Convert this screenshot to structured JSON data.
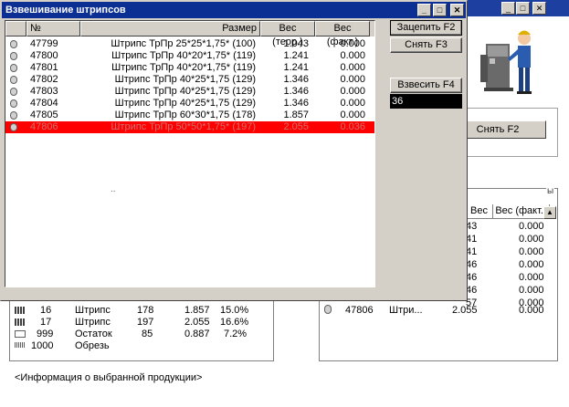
{
  "background": {
    "right_button_label": "Снять F2",
    "group_caption_fragment": "ы",
    "right_table": {
      "headers": [
        "Вес",
        "Вес (факт.)"
      ],
      "rows": [
        {
          "w": "43",
          "f": "0.000"
        },
        {
          "w": "41",
          "f": "0.000"
        },
        {
          "w": "41",
          "f": "0.000"
        },
        {
          "w": "46",
          "f": "0.000"
        },
        {
          "w": "46",
          "f": "0.000"
        },
        {
          "w": "46",
          "f": "0.000"
        },
        {
          "w": "57",
          "f": "0.000"
        }
      ],
      "last_row": {
        "no": "47806",
        "name": "Штри...",
        "w": "2.055",
        "f": "0.000"
      }
    },
    "left_table_rows": [
      {
        "n": "16",
        "name": "Штрипс",
        "len": "178",
        "w": "1.857",
        "pct": "15.0%"
      },
      {
        "n": "17",
        "name": "Штрипс",
        "len": "197",
        "w": "2.055",
        "pct": "16.6%"
      },
      {
        "n": "999",
        "name": "Остаток",
        "len": "85",
        "w": "0.887",
        "pct": "7.2%"
      },
      {
        "n": "1000",
        "name": "Обрезь",
        "len": "",
        "w": "",
        "pct": ""
      }
    ],
    "info_text": "<Информация о выбранной продукции>"
  },
  "dialog": {
    "title": "Взвешивание штрипсов",
    "columns": [
      "№",
      "Размер",
      "Вес (теор.)",
      "Вес (факт.)"
    ],
    "rows": [
      {
        "no": "47799",
        "size": "Штрипс ТрПр 25*25*1,75* (100)",
        "theor": "1.043",
        "fact": "0.000"
      },
      {
        "no": "47800",
        "size": "Штрипс ТрПр 40*20*1,75* (119)",
        "theor": "1.241",
        "fact": "0.000"
      },
      {
        "no": "47801",
        "size": "Штрипс ТрПр 40*20*1,75* (119)",
        "theor": "1.241",
        "fact": "0.000"
      },
      {
        "no": "47802",
        "size": "Штрипс ТрПр 40*25*1,75 (129)",
        "theor": "1.346",
        "fact": "0.000"
      },
      {
        "no": "47803",
        "size": "Штрипс ТрПр 40*25*1,75 (129)",
        "theor": "1.346",
        "fact": "0.000"
      },
      {
        "no": "47804",
        "size": "Штрипс ТрПр 40*25*1,75 (129)",
        "theor": "1.346",
        "fact": "0.000"
      },
      {
        "no": "47805",
        "size": "Штрипс ТрПр 60*30*1,75 (178)",
        "theor": "1.857",
        "fact": "0.000"
      },
      {
        "no": "47806",
        "size": "Штрипс ТрПр 50*50*1,75* (197)",
        "theor": "2.055",
        "fact": "0.036"
      }
    ],
    "grid_dots": "..",
    "btn_hook": "Зацепить F2",
    "btn_remove": "Снять F3",
    "btn_weigh": "Взвесить F4",
    "weight_value": "36"
  },
  "titlebar_buttons": {
    "minimize": "_",
    "maximize": "□",
    "close": "✕"
  },
  "colors": {
    "title": "#0c2f93",
    "selected_row": "#ff0000",
    "face": "#d4d0c8"
  }
}
